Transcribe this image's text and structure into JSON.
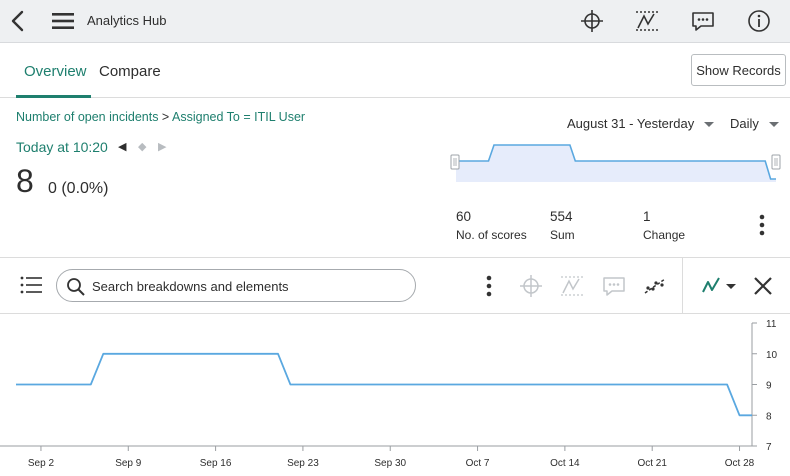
{
  "topbar": {
    "title": "Analytics Hub",
    "icons": [
      "back-icon",
      "hamburger-menu-icon",
      "crosshair-icon",
      "targets-icon",
      "comments-icon",
      "info-icon"
    ]
  },
  "tabs": [
    {
      "label": "Overview",
      "active": true
    },
    {
      "label": "Compare",
      "active": false
    }
  ],
  "show_records_label": "Show Records",
  "breadcrumb": {
    "indicator": "Number of open incidents",
    "separator": " > ",
    "breakdown": "Assigned To = ITIL User"
  },
  "score": {
    "time_label": "Today at 10:20",
    "value": "8",
    "change": "0 (0.0%)"
  },
  "range_select": "August 31 - Yesterday",
  "frequency_select": "Daily",
  "stats": [
    {
      "value": "60",
      "label": "No. of scores"
    },
    {
      "value": "554",
      "label": "Sum"
    },
    {
      "value": "1",
      "label": "Change"
    }
  ],
  "search": {
    "placeholder": "Search breakdowns and elements"
  },
  "colors": {
    "accent": "#1e7f6e",
    "series": "#5aa8e0",
    "spark_fill": "#e6ecfb",
    "topbar_bg": "#eef0f2"
  },
  "chart_data": {
    "type": "line",
    "x_ticks": [
      "Sep 2",
      "Sep 9",
      "Sep 16",
      "Sep 23",
      "Sep 30",
      "Oct 7",
      "Oct 14",
      "Oct 21",
      "Oct 28"
    ],
    "x_start": "2023-08-31",
    "x_end": "2023-10-29",
    "ylim": [
      7,
      11
    ],
    "y_ticks": [
      "7",
      "8",
      "9",
      "10",
      "11"
    ],
    "series": [
      {
        "values": [
          {
            "date": "2023-08-31",
            "y": 9
          },
          {
            "date": "2023-09-06",
            "y": 9
          },
          {
            "date": "2023-09-07",
            "y": 10
          },
          {
            "date": "2023-09-21",
            "y": 10
          },
          {
            "date": "2023-09-22",
            "y": 9
          },
          {
            "date": "2023-10-27",
            "y": 9
          },
          {
            "date": "2023-10-28",
            "y": 8
          },
          {
            "date": "2023-10-29",
            "y": 8
          }
        ]
      }
    ]
  }
}
